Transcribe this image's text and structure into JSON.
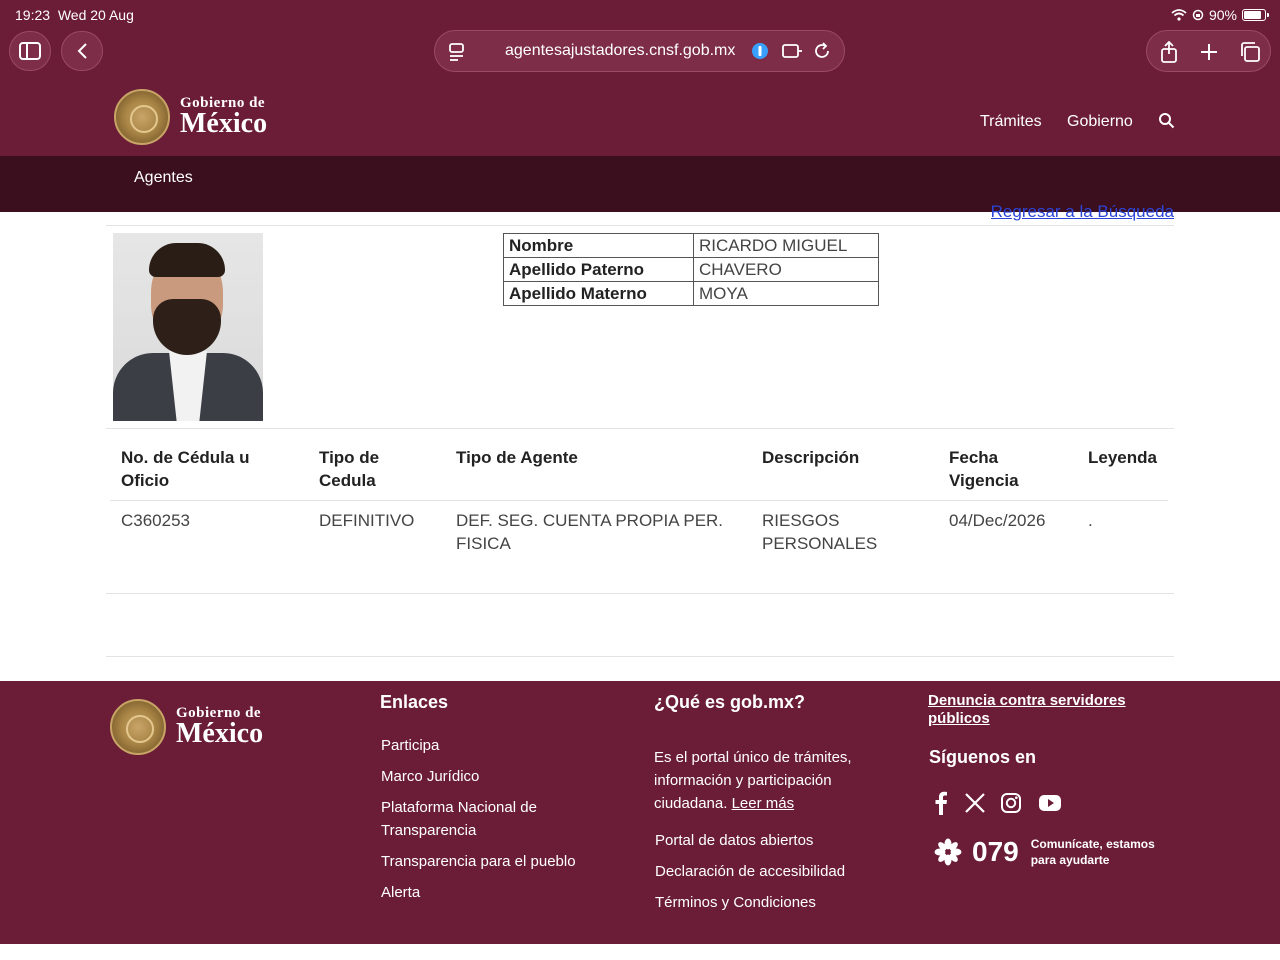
{
  "status_bar": {
    "time": "19:23",
    "date": "Wed 20 Aug",
    "battery": "90%"
  },
  "browser": {
    "url": "agentesajustadores.cnsf.gob.mx"
  },
  "header": {
    "logo_line1": "Gobierno de",
    "logo_line2": "México",
    "nav": [
      "Trámites",
      "Gobierno"
    ]
  },
  "subnav": {
    "item": "Agentes"
  },
  "main": {
    "back_link": "Regresar a la Búsqueda",
    "name_table": [
      {
        "label": "Nombre",
        "value": "RICARDO MIGUEL"
      },
      {
        "label": "Apellido Paterno",
        "value": "CHAVERO"
      },
      {
        "label": "Apellido Materno",
        "value": "MOYA"
      }
    ],
    "columns": [
      "No. de Cédula u Oficio",
      "Tipo de Cedula",
      "Tipo de Agente",
      "Descripción",
      "Fecha Vigencia",
      "Leyenda"
    ],
    "rows": [
      [
        "C360253",
        "DEFINITIVO",
        "DEF. SEG. CUENTA PROPIA PER. FISICA",
        "RIESGOS PERSONALES",
        "04/Dec/2026",
        "."
      ]
    ]
  },
  "footer": {
    "logo_line1": "Gobierno de",
    "logo_line2": "México",
    "enlaces_title": "Enlaces",
    "enlaces": [
      "Participa",
      "Marco Jurídico",
      "Plataforma Nacional de Transparencia",
      "Transparencia para el pueblo",
      "Alerta"
    ],
    "que_es_title": "¿Qué es gob.mx?",
    "que_es_text": "Es el portal único de trámites, información y participación ciudadana.",
    "leer_mas": "Leer más",
    "more_links": [
      "Portal de datos abiertos",
      "Declaración de accesibilidad",
      "Términos y Condiciones"
    ],
    "denuncia": "Denuncia contra servidores públicos",
    "siguenos": "Síguenos en",
    "social_icons": [
      "facebook-icon",
      "x-icon",
      "instagram-icon",
      "youtube-icon"
    ],
    "phone": "079",
    "phone_caption_1": "Comunícate, estamos",
    "phone_caption_2": "para ayudarte"
  },
  "colors": {
    "brand": "#6b1d37",
    "brand_dark": "#3c0f1f",
    "link": "#2c44d6"
  }
}
